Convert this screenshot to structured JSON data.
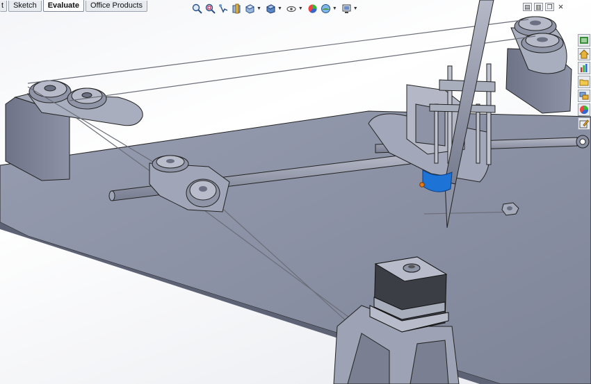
{
  "command_manager": {
    "tabs": [
      {
        "label": "t",
        "active": false
      },
      {
        "label": "Sketch",
        "active": false
      },
      {
        "label": "Evaluate",
        "active": true
      },
      {
        "label": "Office Products",
        "active": false
      }
    ]
  },
  "headsup_toolbar": {
    "icons": [
      "zoom-to-fit-icon",
      "zoom-to-area-icon",
      "previous-view-icon",
      "section-view-icon",
      "view-orientation-icon",
      "display-style-icon",
      "hide-show-items-icon",
      "edit-appearance-icon",
      "apply-scene-icon",
      "view-settings-icon"
    ]
  },
  "window_controls": [
    "tile-horizontal-icon",
    "tile-vertical-icon",
    "restore-icon",
    "close-icon"
  ],
  "window_control_glyphs": {
    "close": "×",
    "restore": "❐",
    "tile_h": "▤",
    "tile_v": "▥"
  },
  "task_pane": {
    "tabs": [
      "solidworks-resources-icon",
      "design-library-icon",
      "file-explorer-icon",
      "view-palette-icon",
      "appearances-icon",
      "custom-properties-icon"
    ]
  },
  "colors": {
    "base_plate": "#8f95a8",
    "part_gray": "#9da3b6",
    "selected_face": "#1e73d6",
    "selection_point": "#e87810"
  }
}
